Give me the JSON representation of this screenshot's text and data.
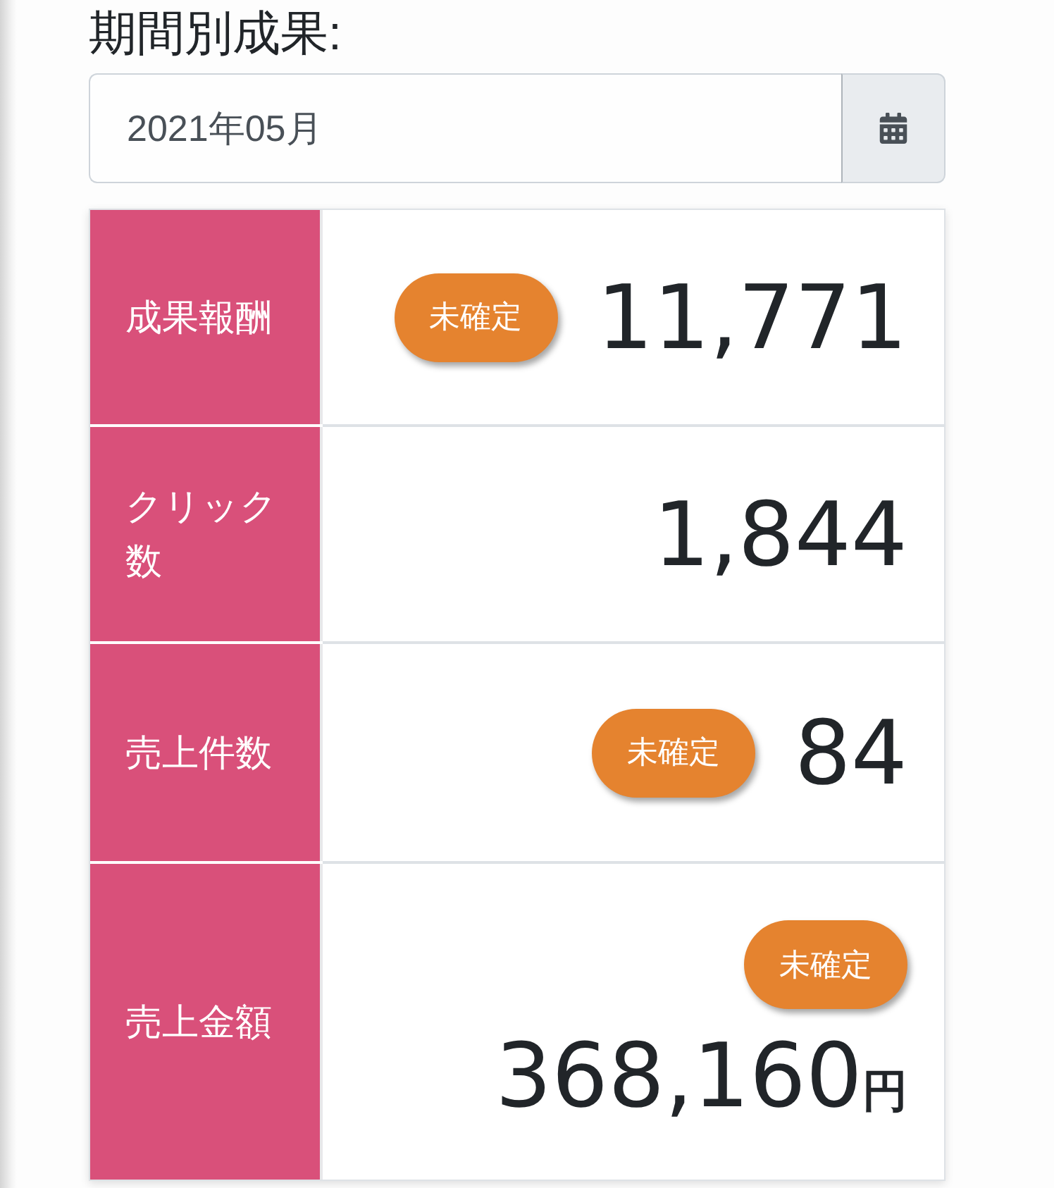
{
  "period_label": "期間別成果:",
  "month_field": {
    "value": "2021年05月"
  },
  "metrics": [
    {
      "kind": "inline",
      "label": "成果報酬",
      "badge": "未確定",
      "value": "11,771"
    },
    {
      "kind": "inline",
      "label": "クリック数",
      "value": "1,844"
    },
    {
      "kind": "inline",
      "label": "売上件数",
      "badge": "未確定",
      "value": "84"
    },
    {
      "kind": "stacked",
      "label": "売上金額",
      "badge": "未確定",
      "value": "368,160",
      "unit": "円"
    }
  ]
}
